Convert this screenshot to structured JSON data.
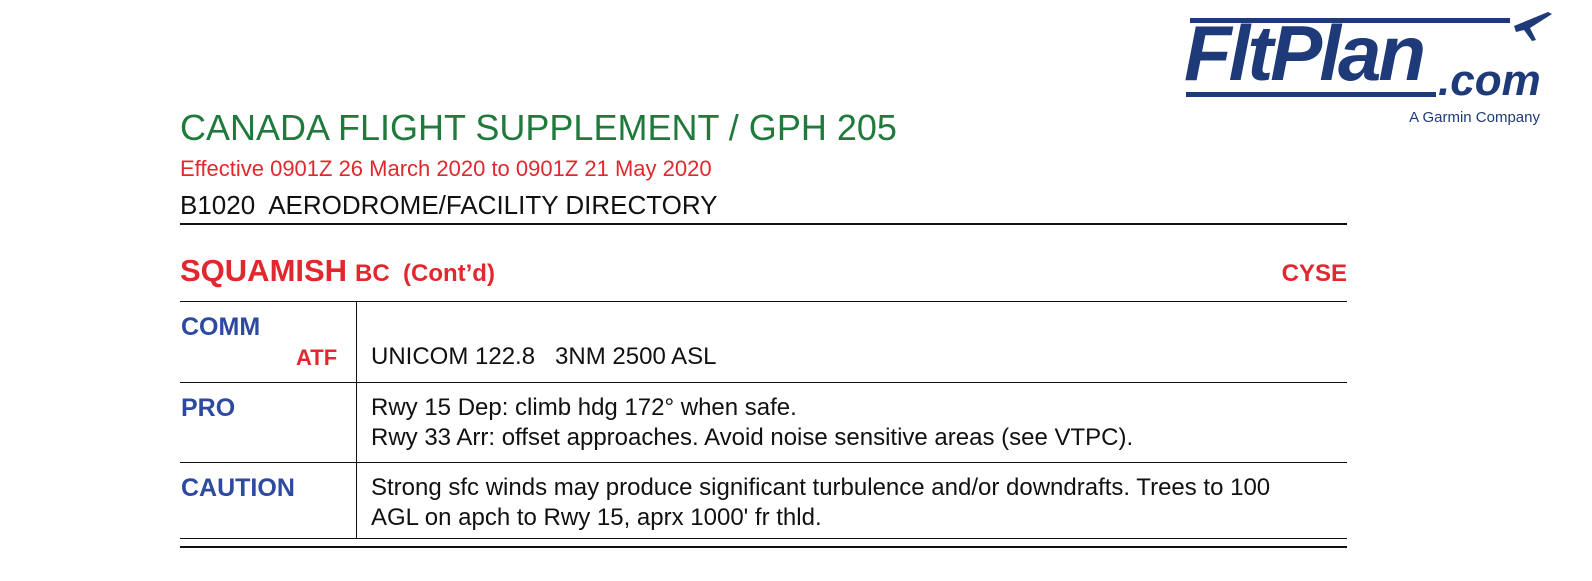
{
  "logo": {
    "word": "FltPlan",
    "suffix": ".com",
    "tagline": "A Garmin Company"
  },
  "header": {
    "title": "CANADA FLIGHT SUPPLEMENT / GPH 205",
    "effective": "Effective 0901Z 26 March 2020 to 0901Z 21 May 2020",
    "section": "B1020  AERODROME/FACILITY DIRECTORY"
  },
  "aerodrome": {
    "name": "SQUAMISH",
    "province_cont": "BC  (Cont’d)",
    "code": "CYSE"
  },
  "rows": {
    "comm": {
      "label": "COMM",
      "sublabel": "ATF",
      "text": "UNICOM 122.8   3NM 2500 ASL"
    },
    "pro": {
      "label": "PRO",
      "line1": "Rwy 15 Dep: climb hdg 172° when safe.",
      "line2": "Rwy 33 Arr: offset approaches. Avoid noise sensitive areas (see VTPC)."
    },
    "caution": {
      "label": "CAUTION",
      "line1": "Strong sfc winds may produce significant turbulence and/or downdrafts. Trees to 100",
      "line2": "AGL on apch to Rwy 15, aprx 1000' fr thld."
    }
  },
  "colors": {
    "title_green": "#1f7a3b",
    "accent_red": "#e0282e",
    "label_blue": "#2e4aa0",
    "logo_navy": "#1f3a78"
  }
}
